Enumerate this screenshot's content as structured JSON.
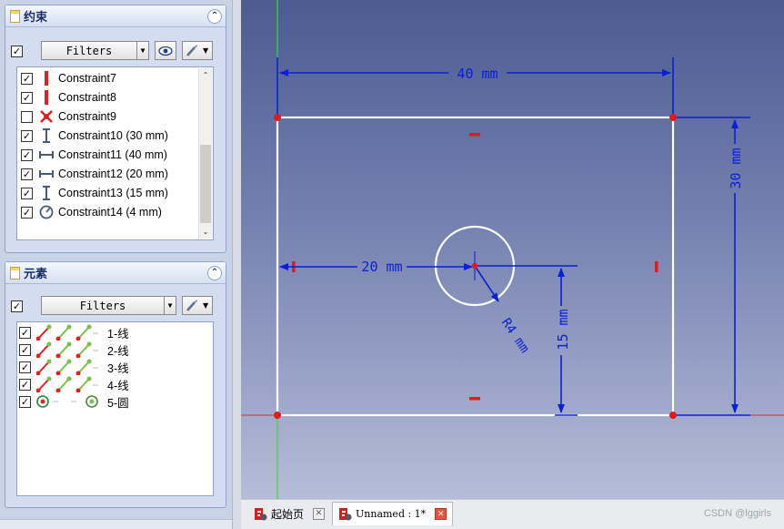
{
  "constraints_panel": {
    "title": "约束",
    "filters_label": "Filters",
    "items": [
      {
        "checked": true,
        "label": "Constraint7",
        "icon": "vertical-constraint-icon"
      },
      {
        "checked": true,
        "label": "Constraint8",
        "icon": "vertical-constraint-icon"
      },
      {
        "checked": false,
        "label": "Constraint9",
        "icon": "point-on-point-constraint-icon"
      },
      {
        "checked": true,
        "label": "Constraint10 (30 mm)",
        "icon": "vertical-distance-icon"
      },
      {
        "checked": true,
        "label": "Constraint11 (40 mm)",
        "icon": "horizontal-distance-icon"
      },
      {
        "checked": true,
        "label": "Constraint12 (20 mm)",
        "icon": "horizontal-distance-icon"
      },
      {
        "checked": true,
        "label": "Constraint13 (15 mm)",
        "icon": "vertical-distance-icon"
      },
      {
        "checked": true,
        "label": "Constraint14 (4 mm)",
        "icon": "radius-constraint-icon"
      }
    ]
  },
  "elements_panel": {
    "title": "元素",
    "filters_label": "Filters",
    "items": [
      {
        "checked": true,
        "label": "1-线",
        "kind": "line"
      },
      {
        "checked": true,
        "label": "2-线",
        "kind": "line"
      },
      {
        "checked": true,
        "label": "3-线",
        "kind": "line"
      },
      {
        "checked": true,
        "label": "4-线",
        "kind": "line"
      },
      {
        "checked": true,
        "label": "5-圆",
        "kind": "circle"
      }
    ]
  },
  "sketch": {
    "dim_width": "40 mm",
    "dim_height": "30 mm",
    "dim_center_x": "20 mm",
    "dim_center_y": "15 mm",
    "dim_radius": "R4 mm",
    "colors": {
      "geometry": "#ffffff",
      "dimension": "#0a1fd6",
      "point": "#e01b1b",
      "axis_y": "#33dd33",
      "axis_x": "#cc3b3b"
    }
  },
  "tabs": [
    {
      "label": "起始页",
      "active": false
    },
    {
      "label": "Unnamed : 1*",
      "active": true
    }
  ],
  "watermark": "CSDN @lggirls"
}
